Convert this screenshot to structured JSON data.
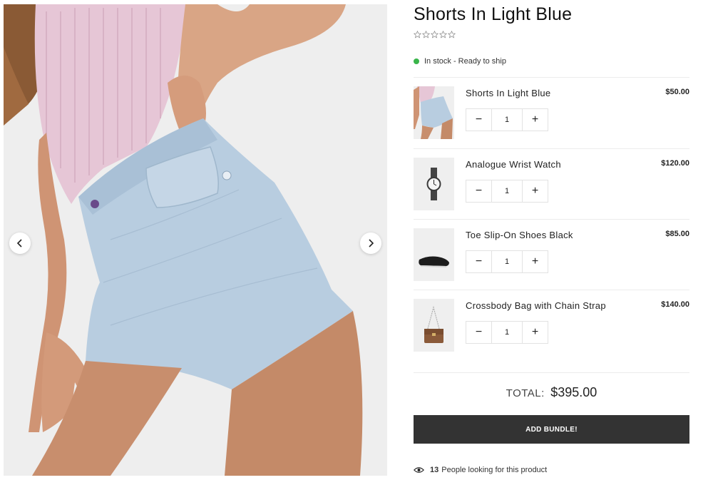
{
  "product": {
    "title": "Shorts In Light Blue",
    "rating_stars": 5,
    "rating_filled": 0,
    "stock_text": "In stock - Ready to ship",
    "stock_color": "#39b54a"
  },
  "gallery": {
    "prev_icon": "chevron-left-icon",
    "next_icon": "chevron-right-icon"
  },
  "bundle": {
    "items": [
      {
        "name": "Shorts In Light Blue",
        "price": "$50.00",
        "qty": "1",
        "thumb": "shorts"
      },
      {
        "name": "Analogue Wrist Watch",
        "price": "$120.00",
        "qty": "1",
        "thumb": "watch"
      },
      {
        "name": "Toe Slip-On Shoes Black",
        "price": "$85.00",
        "qty": "1",
        "thumb": "shoes"
      },
      {
        "name": "Crossbody Bag with Chain Strap",
        "price": "$140.00",
        "qty": "1",
        "thumb": "bag"
      }
    ],
    "minus_label": "−",
    "plus_label": "+",
    "total_label": "TOTAL:",
    "total_value": "$395.00",
    "button_label": "ADD BUNDLE!"
  },
  "viewers": {
    "count": "13",
    "text": "People looking for this product",
    "icon": "eye-icon"
  },
  "colors": {
    "button_bg": "#333333",
    "divider": "#ececec"
  }
}
